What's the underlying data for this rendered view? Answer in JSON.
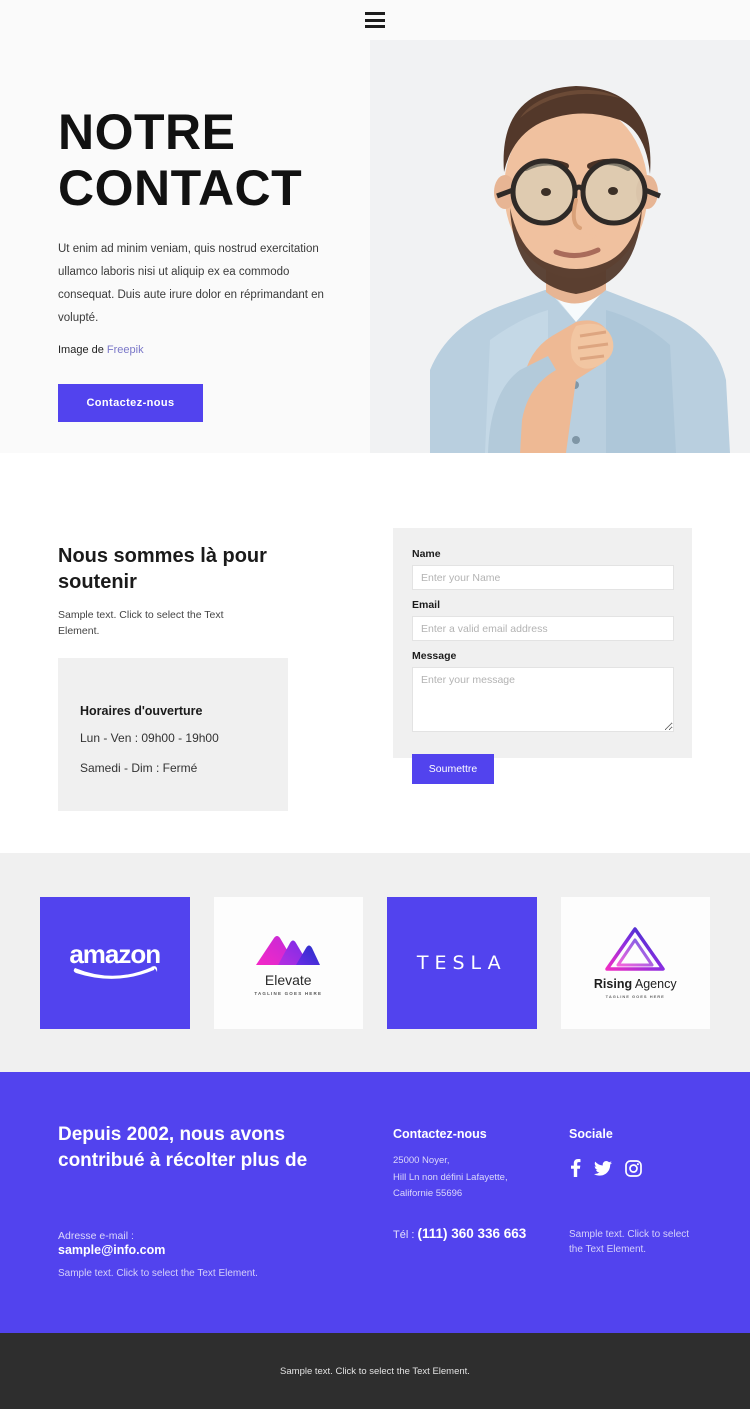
{
  "header": {
    "menu_icon": "hamburger-menu-icon"
  },
  "hero": {
    "title_line1": "NOTRE",
    "title_line2": "CONTACT",
    "paragraph": "Ut enim ad minim veniam, quis nostrud exercitation ullamco laboris nisi ut aliquip ex ea commodo consequat. Duis aute irure dolor en réprimandant en volupté.",
    "credit_prefix": "Image de ",
    "credit_link": "Freepik",
    "cta_label": "Contactez-nous",
    "accent_color": "#5243ee",
    "link_color": "#7a77c8",
    "background": "#fafafa"
  },
  "support": {
    "title": "Nous sommes là pour soutenir",
    "subtitle": "Sample text. Click to select the Text Element.",
    "hours": {
      "title": "Horaires d'ouverture",
      "weekday": "Lun - Ven : 09h00 - 19h00",
      "weekend": "Samedi - Dim : Fermé"
    }
  },
  "form": {
    "name_label": "Name",
    "name_placeholder": "Enter your Name",
    "name_value": "",
    "email_label": "Email",
    "email_placeholder": "Enter a valid email address",
    "email_value": "",
    "message_label": "Message",
    "message_placeholder": "Enter your message",
    "message_value": "",
    "submit_label": "Soumettre",
    "card_background": "#f0f0f0"
  },
  "logos": [
    {
      "name": "amazon",
      "style": "purple",
      "word": "amazon"
    },
    {
      "name": "elevate",
      "style": "white",
      "word": "Elevate",
      "tagline": "TAGLINE GOES HERE"
    },
    {
      "name": "tesla",
      "style": "purple",
      "word": "TESLA"
    },
    {
      "name": "rising-agency",
      "style": "white",
      "word_bold": "Rising",
      "word_light": " Agency",
      "tagline": "TAGLINE GOES HERE"
    }
  ],
  "footer": {
    "heading": "Depuis 2002, nous avons contribué à récolter plus de",
    "email_label": "Adresse e-mail :",
    "email_value": "sample@info.com",
    "note_left": "Sample text. Click to select the Text Element.",
    "contact_title": "Contactez-nous",
    "address_line1": "25000 Noyer,",
    "address_line2": "Hill Ln non défini Lafayette,",
    "address_line3": "Californie 55696",
    "tel_label": "Tél :",
    "tel_value": "(111) 360 336 663",
    "social_title": "Sociale",
    "social_icons": [
      "facebook-icon",
      "twitter-icon",
      "instagram-icon"
    ],
    "note_right": "Sample text. Click to select the Text Element.",
    "background": "#5243ee"
  },
  "bottombar": {
    "text": "Sample text. Click to select the Text Element.",
    "background": "#2e2e2e"
  }
}
